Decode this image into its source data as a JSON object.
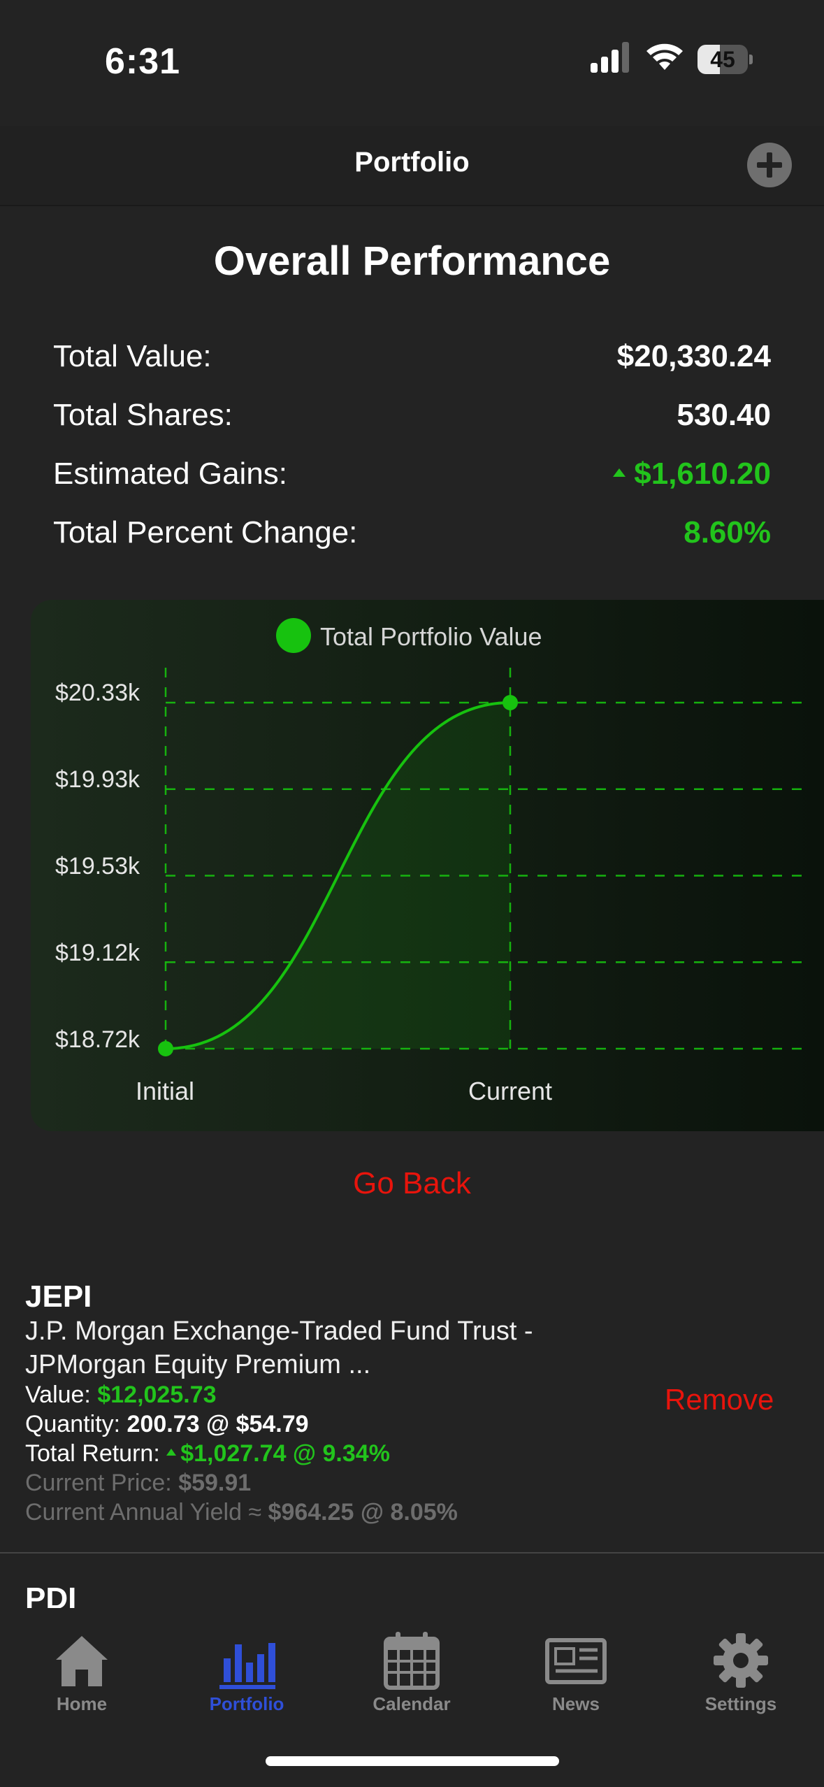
{
  "status": {
    "time": "6:31",
    "battery": "45",
    "battery_level": 0.45
  },
  "nav": {
    "title": "Portfolio",
    "add_icon": "plus-circle-icon"
  },
  "overview": {
    "title": "Overall Performance",
    "rows": [
      {
        "label": "Total Value:",
        "value": "$20,330.24"
      },
      {
        "label": "Total Shares:",
        "value": "530.40"
      },
      {
        "label": "Estimated Gains:",
        "value": "$1,610.20"
      },
      {
        "label": "Total Percent Change:",
        "value": "8.60%"
      }
    ]
  },
  "chart_data": {
    "type": "line",
    "categories": [
      "Initial",
      "Current"
    ],
    "series": [
      {
        "name": "Total Portfolio Value",
        "values": [
          18720,
          20330.24
        ]
      }
    ],
    "yticks": [
      "$18.72k",
      "$19.12k",
      "$19.53k",
      "$19.93k",
      "$20.33k"
    ],
    "ylim": [
      18720,
      20330.24
    ],
    "grid": true,
    "legend": "top",
    "color": "#17c20f"
  },
  "actions": {
    "go_back": "Go Back"
  },
  "holdings": [
    {
      "symbol": "JEPI",
      "name": "J.P. Morgan Exchange-Traded Fund Trust - JPMorgan Equity Premium ...",
      "value_label": "Value:",
      "value": "$12,025.73",
      "quantity_label": "Quantity:",
      "quantity": "200.73 @ $54.79",
      "return_label": "Total Return:",
      "return": "$1,027.74 @ 9.34%",
      "price_label": "Current Price:",
      "price": "$59.91",
      "yield_label": "Current Annual Yield ≈",
      "yield": "$964.25 @ 8.05%",
      "remove": "Remove"
    },
    {
      "symbol": "PDI"
    }
  ],
  "tabs": [
    {
      "label": "Home",
      "icon": "home-icon"
    },
    {
      "label": "Portfolio",
      "icon": "bar-chart-icon",
      "active": true
    },
    {
      "label": "Calendar",
      "icon": "calendar-icon"
    },
    {
      "label": "News",
      "icon": "newspaper-icon"
    },
    {
      "label": "Settings",
      "icon": "gear-icon"
    }
  ]
}
